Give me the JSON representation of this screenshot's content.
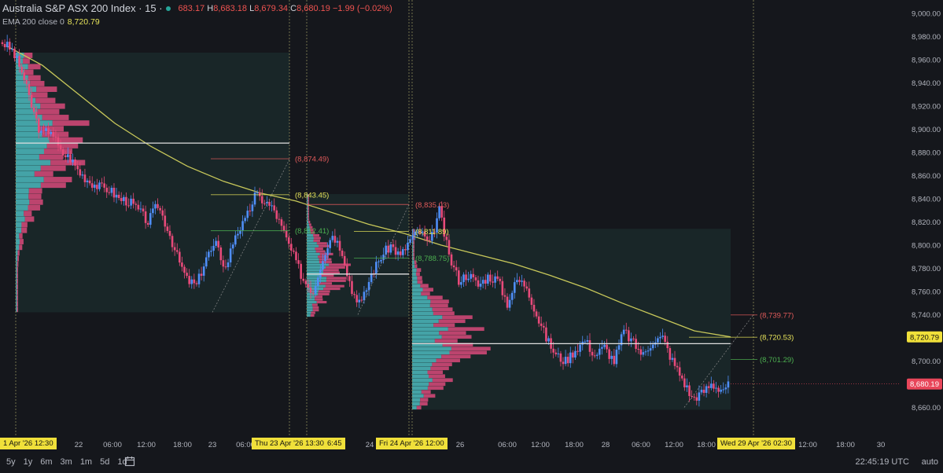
{
  "header": {
    "symbol_title": "Australia S&P ASX 200 Index · 15 ·",
    "ohlc": {
      "o": "683.17",
      "h": "8,683.18",
      "l": "8,679.34",
      "c": "8,680.19",
      "chg": "−1.99 (−0.02%)"
    },
    "ema_label": "EMA 200 close 0",
    "ema_value": "8,720.79"
  },
  "colors": {
    "up": "#4f8ef7",
    "down": "#e84a7a",
    "ema": "#c8c85a",
    "vp_up": "#4fc3c7",
    "vp_down": "#d94a7a",
    "bg": "#15171c"
  },
  "chart_data": {
    "type": "candlestick",
    "y_ticks": [
      8660,
      8680,
      8700,
      8720,
      8740,
      8760,
      8780,
      8800,
      8820,
      8840,
      8860,
      8880,
      8900,
      8920,
      8940,
      8960,
      8980,
      9000
    ],
    "y_tick_labels": [
      "8,660.00",
      "8,680.00",
      "8,700.00",
      "8,720.00",
      "8,740.00",
      "8,760.00",
      "8,780.00",
      "8,800.00",
      "8,820.00",
      "8,840.00",
      "8,860.00",
      "8,880.00",
      "8,900.00",
      "8,920.00",
      "8,940.00",
      "8,960.00",
      "8,980.00",
      "9,000.00"
    ],
    "ylim": [
      8640,
      9006
    ],
    "x_ticks": [
      "22",
      "06:00",
      "12:00",
      "18:00",
      "23",
      "06:00",
      "24",
      "26",
      "06:00",
      "12:00",
      "18:00",
      "28",
      "06:00",
      "12:00",
      "18:00",
      "12:00",
      "18:00",
      "30"
    ],
    "time_badges": [
      "1 Apr '26   12:30",
      "Thu 23 Apr '26   13:30",
      "6:45",
      "Fri 24 Apr '26   12:00",
      "Wed 29 Apr '26   02:30"
    ],
    "price_labels": [
      {
        "text": "(8,874.49)",
        "price": 8874.49,
        "color": "#e05a5a"
      },
      {
        "text": "(8,843.45)",
        "price": 8843.45,
        "color": "#e6e35a"
      },
      {
        "text": "(8,812.41)",
        "price": 8812.41,
        "color": "#4caf50"
      },
      {
        "text": "(8,835.03)",
        "price": 8835.03,
        "color": "#e05a5a"
      },
      {
        "text": "(8,811.89)",
        "price": 8811.89,
        "color": "#e6e35a"
      },
      {
        "text": "(8,788.75)",
        "price": 8788.75,
        "color": "#4caf50"
      },
      {
        "text": "(8,739.77)",
        "price": 8739.77,
        "color": "#e05a5a"
      },
      {
        "text": "(8,720.53)",
        "price": 8720.53,
        "color": "#e6e35a"
      },
      {
        "text": "(8,701.29)",
        "price": 8701.29,
        "color": "#4caf50"
      }
    ],
    "ema_tag": "8,720.79",
    "last_price_tag": "8,680.19",
    "ema_series": [
      8972,
      8955,
      8930,
      8905,
      8885,
      8868,
      8855,
      8845,
      8838,
      8828,
      8818,
      8810,
      8800,
      8792,
      8784,
      8774,
      8763,
      8750,
      8738,
      8726,
      8720.79
    ],
    "price_path": [
      8975,
      8968,
      8950,
      8920,
      8895,
      8900,
      8880,
      8875,
      8862,
      8855,
      8850,
      8848,
      8840,
      8838,
      8830,
      8820,
      8835,
      8815,
      8790,
      8770,
      8765,
      8790,
      8800,
      8780,
      8810,
      8820,
      8843,
      8838,
      8830,
      8810,
      8790,
      8770,
      8760,
      8790,
      8810,
      8795,
      8760,
      8750,
      8775,
      8790,
      8800,
      8790,
      8805,
      8812,
      8800,
      8830,
      8790,
      8770,
      8775,
      8765,
      8773,
      8770,
      8750,
      8770,
      8765,
      8740,
      8720,
      8705,
      8700,
      8710,
      8718,
      8705,
      8712,
      8700,
      8726,
      8715,
      8705,
      8718,
      8720,
      8700,
      8685,
      8668,
      8672,
      8680,
      8676,
      8680
    ]
  },
  "bottom_bar": {
    "ranges": [
      "5y",
      "1y",
      "6m",
      "3m",
      "1m",
      "5d",
      "1d"
    ],
    "clock": "22:45:19 UTC",
    "auto": "auto"
  }
}
